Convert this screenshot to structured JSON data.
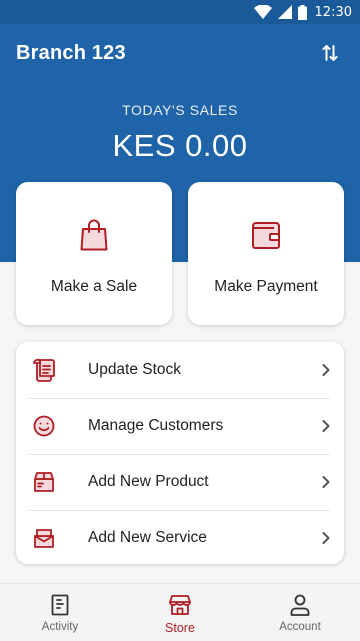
{
  "status_bar": {
    "time": "12:30"
  },
  "header": {
    "branch_name": "Branch 123"
  },
  "sales": {
    "label": "TODAY'S SALES",
    "value": "KES 0.00"
  },
  "actions": [
    {
      "label": "Make a Sale",
      "icon": "shopping-bag-icon"
    },
    {
      "label": "Make Payment",
      "icon": "wallet-icon"
    }
  ],
  "menu": [
    {
      "label": "Update Stock",
      "icon": "receipt-icon"
    },
    {
      "label": "Manage Customers",
      "icon": "smiley-icon"
    },
    {
      "label": "Add New Product",
      "icon": "product-box-icon"
    },
    {
      "label": "Add New Service",
      "icon": "service-box-icon"
    }
  ],
  "bottom_nav": [
    {
      "label": "Activity",
      "icon": "activity-icon",
      "active": false
    },
    {
      "label": "Store",
      "icon": "store-icon",
      "active": true
    },
    {
      "label": "Account",
      "icon": "account-icon",
      "active": false
    }
  ],
  "colors": {
    "primary": "#1f64a9",
    "accent": "#b01e23",
    "icon_fill": "#f6d9dd"
  }
}
